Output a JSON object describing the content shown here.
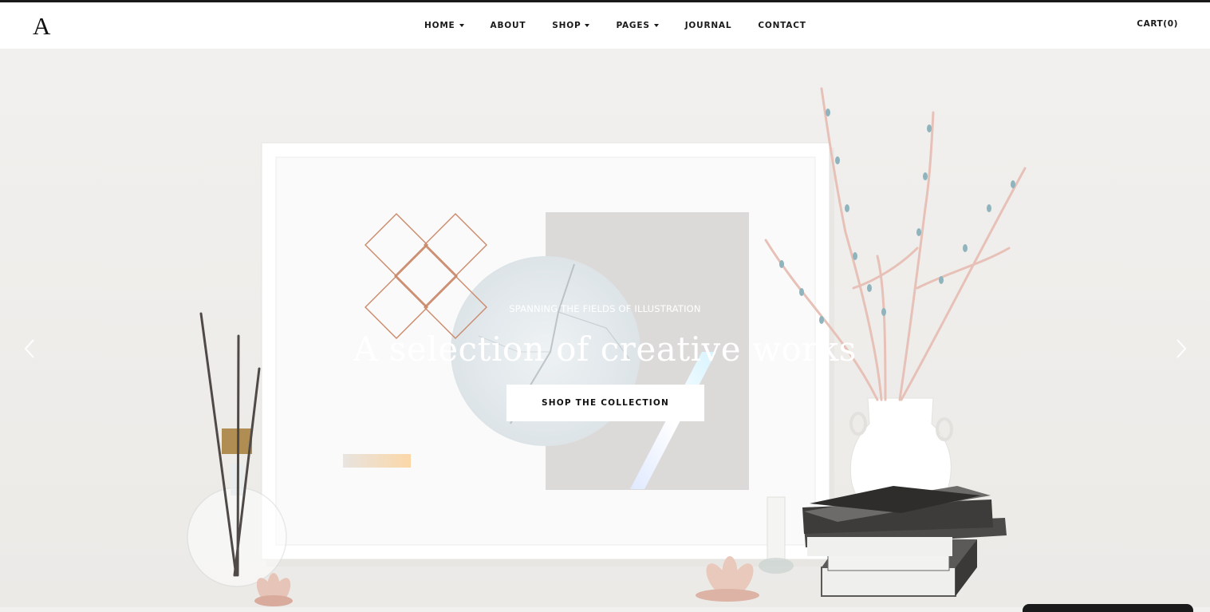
{
  "brand": {
    "logo_text": "A"
  },
  "nav": {
    "items": [
      {
        "label": "HOME",
        "has_dropdown": true
      },
      {
        "label": "ABOUT",
        "has_dropdown": false
      },
      {
        "label": "SHOP",
        "has_dropdown": true
      },
      {
        "label": "PAGES",
        "has_dropdown": true
      },
      {
        "label": "JOURNAL",
        "has_dropdown": false
      },
      {
        "label": "CONTACT",
        "has_dropdown": false
      }
    ],
    "cart_label": "CART(0)"
  },
  "hero": {
    "subtitle": "SPANNING THE FIELDS OF ILLUSTRATION",
    "title": "A selection of creative works",
    "cta_label": "SHOP THE COLLECTION",
    "prev_icon": "chevron-left-icon",
    "next_icon": "chevron-right-icon"
  },
  "colors": {
    "background": "#f1f0ee",
    "header_bg": "#ffffff",
    "text_dark": "#1a1a1a",
    "accent_copper": "#c9896a",
    "accent_peach": "#f6d6ad"
  }
}
